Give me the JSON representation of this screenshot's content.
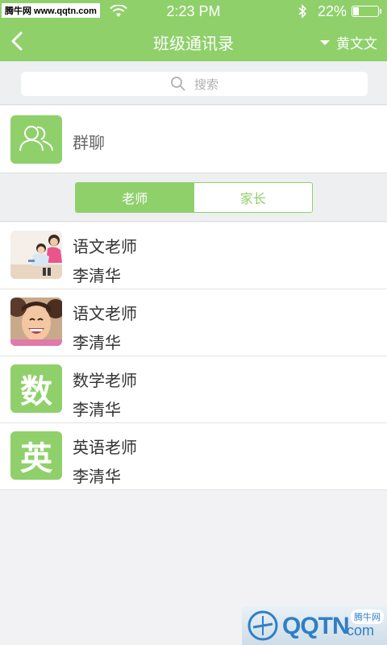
{
  "status_bar": {
    "watermark": "腾牛网 www.qqtn.com",
    "time": "2:23 PM",
    "battery": "22%",
    "battery_level": 0.22
  },
  "nav": {
    "title": "班级通讯录",
    "user_name": "黄文文"
  },
  "search": {
    "placeholder": "搜索"
  },
  "group_chat": {
    "label": "群聊"
  },
  "tabs": [
    {
      "label": "老师",
      "active": true
    },
    {
      "label": "家长",
      "active": false
    }
  ],
  "contacts": [
    {
      "role": "语文老师",
      "name": "李清华",
      "avatar": "photo-mother-child"
    },
    {
      "role": "语文老师",
      "name": "李清华",
      "avatar": "photo-laughing-kids"
    },
    {
      "role": "数学老师",
      "name": "李清华",
      "avatar_text": "数"
    },
    {
      "role": "英语老师",
      "name": "李清华",
      "avatar_text": "英"
    }
  ],
  "watermark_bottom": {
    "brand": "QQTN",
    "suffix": "com",
    "badge": "腾牛网"
  },
  "colors": {
    "accent": "#8fd06b",
    "background": "#f2f2f4"
  }
}
